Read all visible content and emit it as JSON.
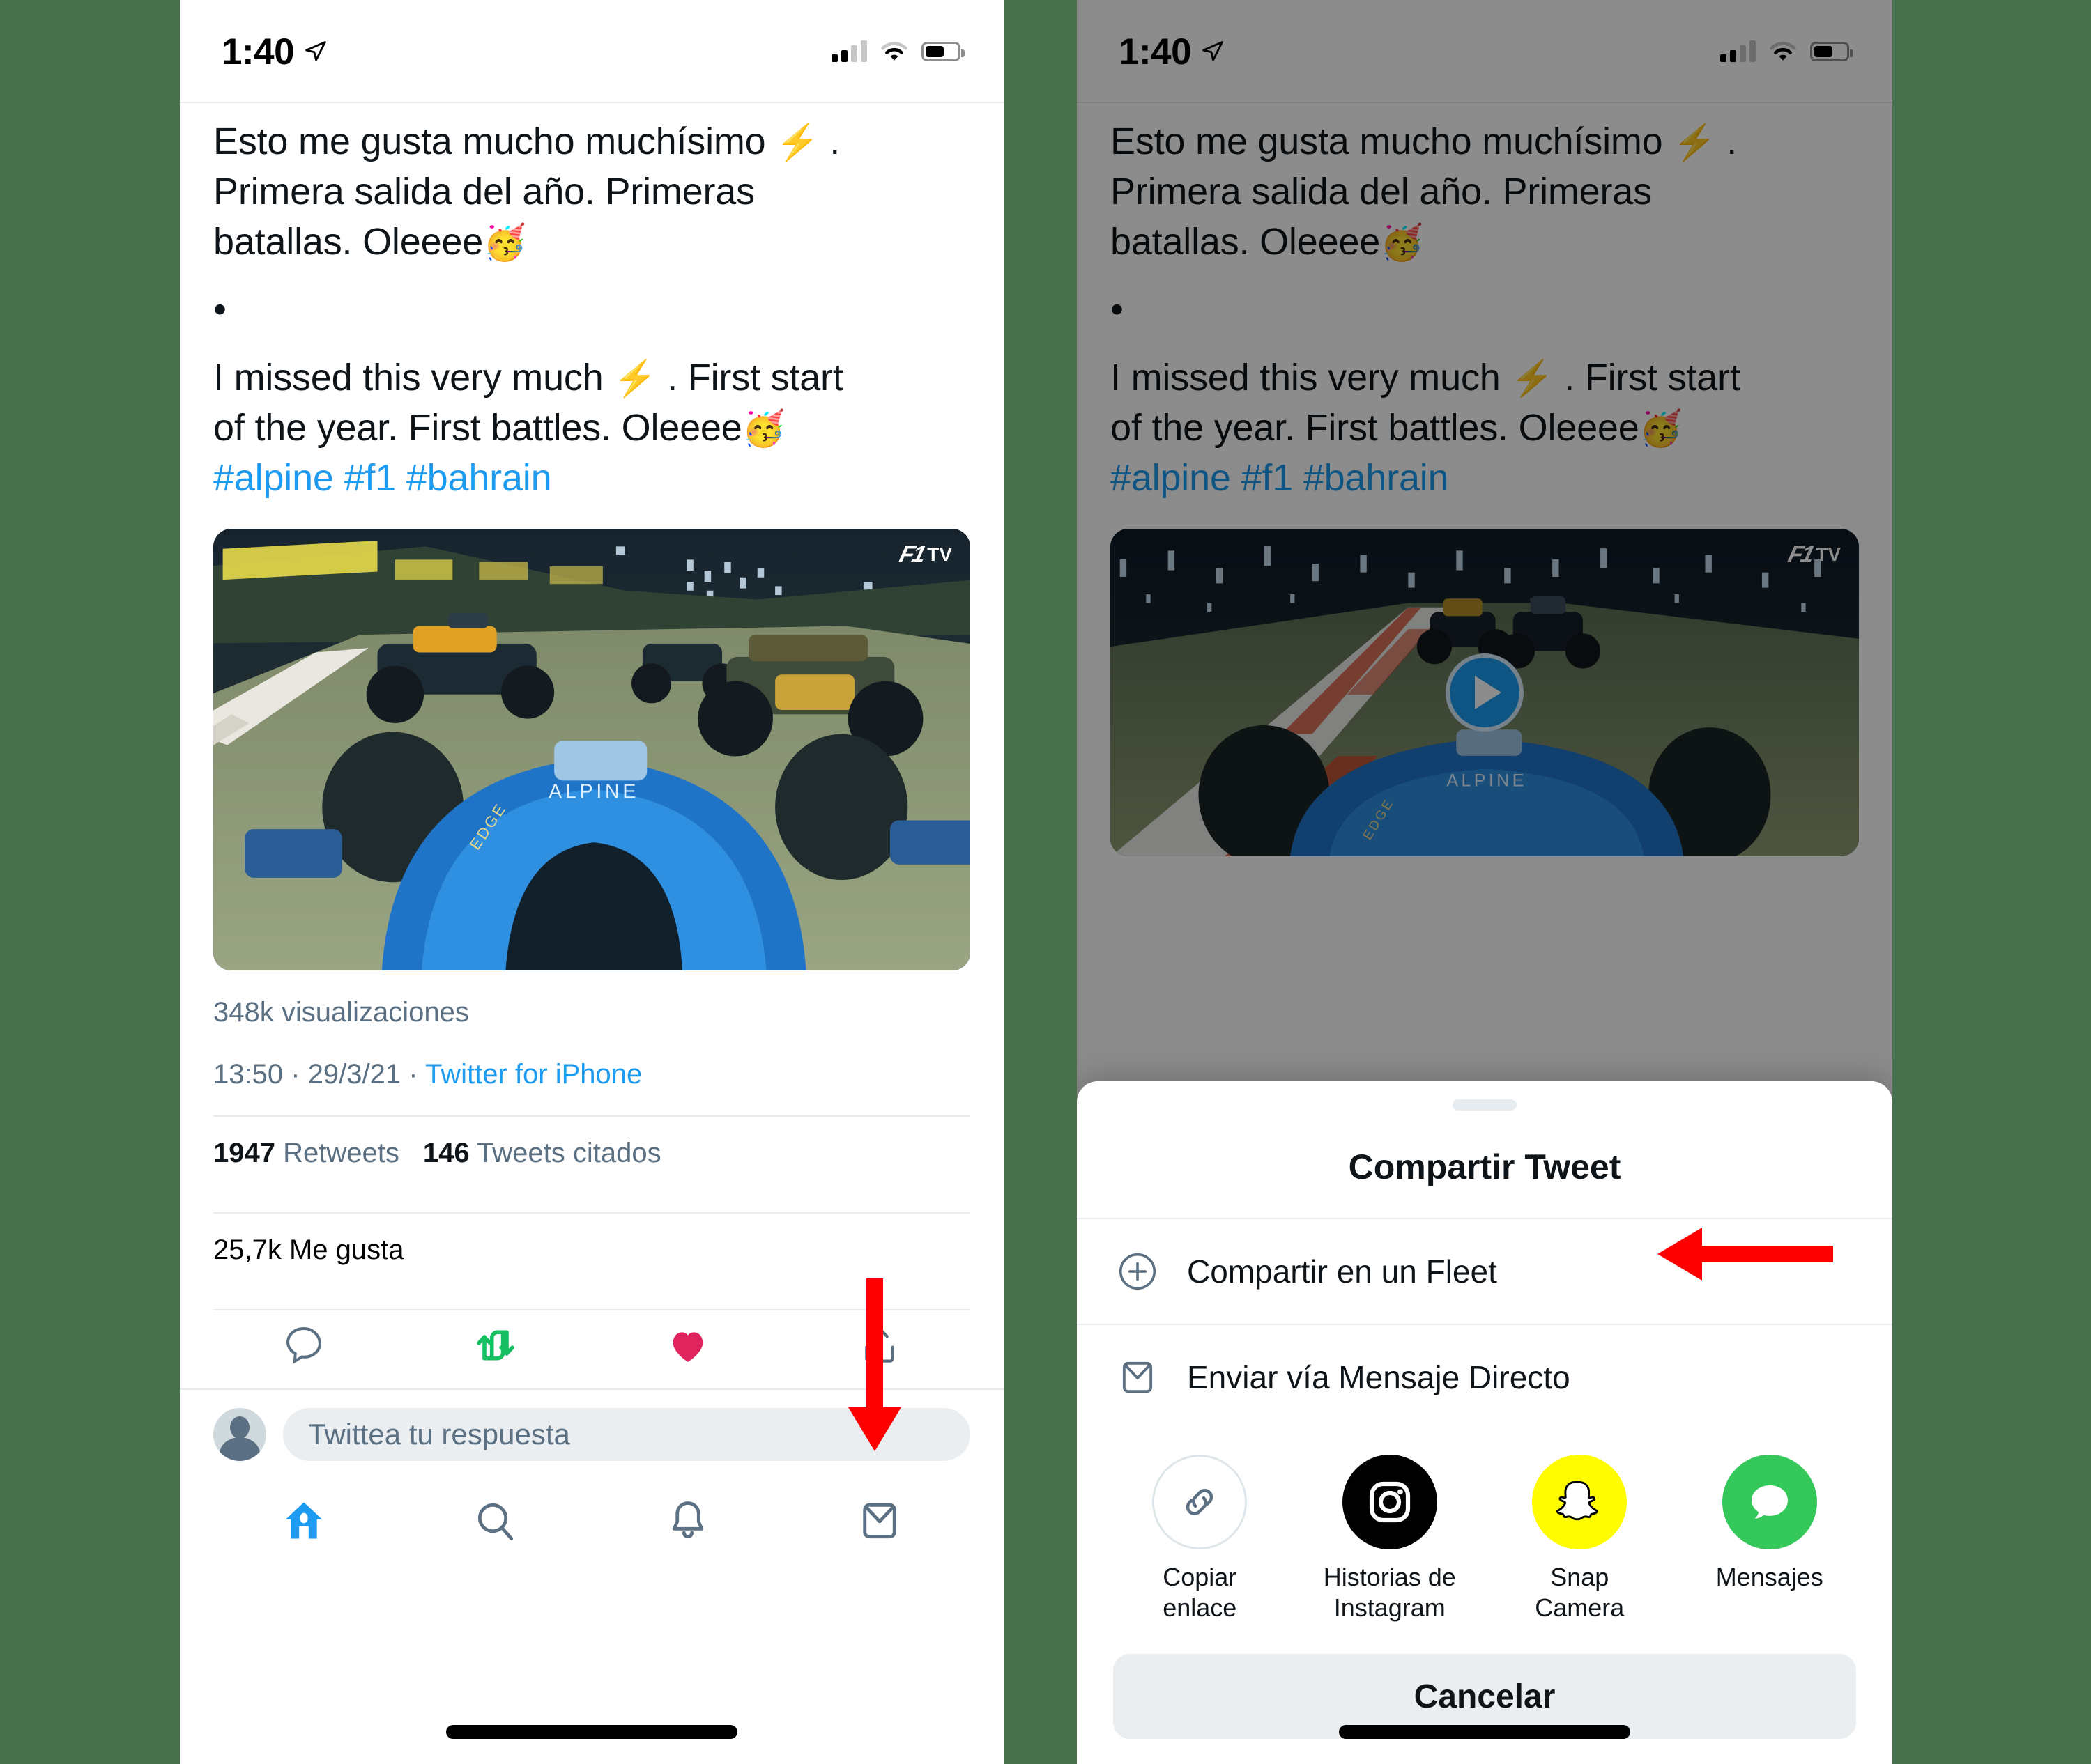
{
  "background_color": "#47704c",
  "accent_color": "#1d9bf0",
  "annotation_color": "#ff0000",
  "status_bar": {
    "time": "1:40",
    "location_icon": "location-arrow-icon",
    "signal_icon": "cellular-signal-icon",
    "wifi_icon": "wifi-icon",
    "battery_icon": "battery-icon"
  },
  "tweet": {
    "line1": "Esto me gusta mucho muchísimo ",
    "emoji1": "⚡",
    "line1b": " .",
    "line2": "Primera salida del año. Primeras",
    "line3": "batallas. Oleeee",
    "emoji2": "🥳",
    "bullet": "•",
    "line4": "I missed this very much ",
    "emoji3": "⚡",
    "line4b": " .  First start",
    "line5": "of the year.  First battles.  Oleeee",
    "emoji4": "🥳",
    "hashtags": "#alpine #f1 #bahrain",
    "media": {
      "badge_f1": "F1",
      "badge_tv": "TV",
      "alpine_text": "ALPINE",
      "play_icon": "play-icon"
    },
    "views": "348k visualizaciones",
    "time": "13:50",
    "dot1": "·",
    "date": "29/3/21",
    "dot2": "·",
    "source": "Twitter for iPhone",
    "retweets_count": "1947",
    "retweets_label": "Retweets",
    "quotes_count": "146",
    "quotes_label": "Tweets citados",
    "likes_count": "25,7k",
    "likes_label": "Me gusta",
    "actions": [
      {
        "name": "reply-icon",
        "label": "Responder"
      },
      {
        "name": "retweet-icon",
        "label": "Retwittear"
      },
      {
        "name": "like-icon",
        "label": "Me gusta"
      },
      {
        "name": "share-icon",
        "label": "Compartir"
      }
    ]
  },
  "reply_bar": {
    "avatar": "default-avatar",
    "placeholder": "Twittea tu respuesta"
  },
  "bottom_nav": [
    {
      "name": "home-icon",
      "label": "Inicio",
      "active": true
    },
    {
      "name": "search-icon",
      "label": "Buscar",
      "active": false
    },
    {
      "name": "bell-icon",
      "label": "Notificaciones",
      "active": false
    },
    {
      "name": "mail-icon",
      "label": "Mensajes",
      "active": false
    }
  ],
  "share_sheet": {
    "title": "Compartir Tweet",
    "rows": [
      {
        "icon": "plus-circle-icon",
        "label": "Compartir en un Fleet"
      },
      {
        "icon": "envelope-icon",
        "label": "Enviar vía Mensaje Directo"
      }
    ],
    "apps": [
      {
        "icon": "link-icon",
        "label": "Copiar\nenlace",
        "label_line1": "Copiar",
        "label_line2": "enlace",
        "color": "#ffffff"
      },
      {
        "icon": "instagram-icon",
        "label_line1": "Historias de",
        "label_line2": "Instagram",
        "color": "#000000"
      },
      {
        "icon": "snapchat-icon",
        "label_line1": "Snap",
        "label_line2": "Camera",
        "color": "#FFFC00"
      },
      {
        "icon": "messages-icon",
        "label_line1": "Mensajes",
        "label_line2": "",
        "color": "#34C759"
      }
    ],
    "cancel_label": "Cancelar"
  },
  "annotations": [
    {
      "name": "arrow-down-to-share-button",
      "direction": "down",
      "color": "#ff0000"
    },
    {
      "name": "arrow-left-to-direct-message",
      "direction": "left",
      "color": "#ff0000"
    }
  ]
}
